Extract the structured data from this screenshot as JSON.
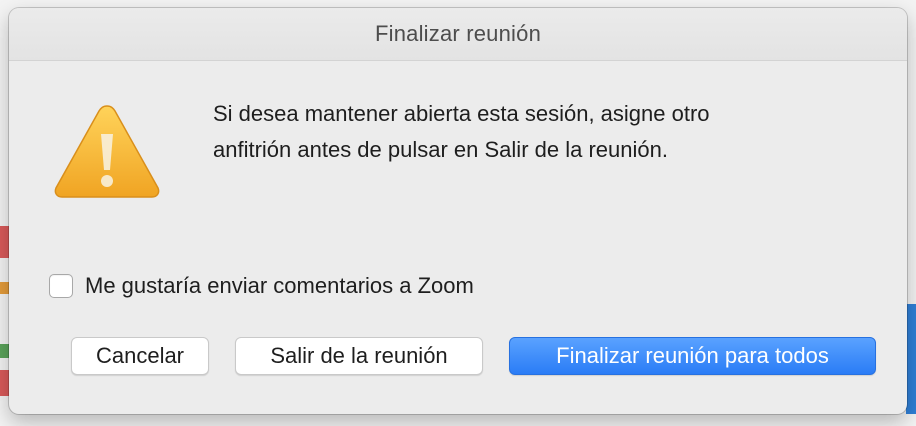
{
  "dialog": {
    "title": "Finalizar reunión",
    "message_line1": "Si desea mantener abierta esta sesión, asigne otro",
    "message_line2": "anfitrión antes de pulsar en Salir de la reunión.",
    "icon": "warning-triangle-icon",
    "checkbox": {
      "label": "Me gustaría enviar comentarios a Zoom",
      "checked": false
    },
    "buttons": {
      "cancel": "Cancelar",
      "leave": "Salir de la reunión",
      "end_for_all": "Finalizar reunión para todos"
    }
  },
  "colors": {
    "dialog_bg": "#ececec",
    "primary_button": "#2a7cf6",
    "warning_yellow": "#f6b93b"
  }
}
